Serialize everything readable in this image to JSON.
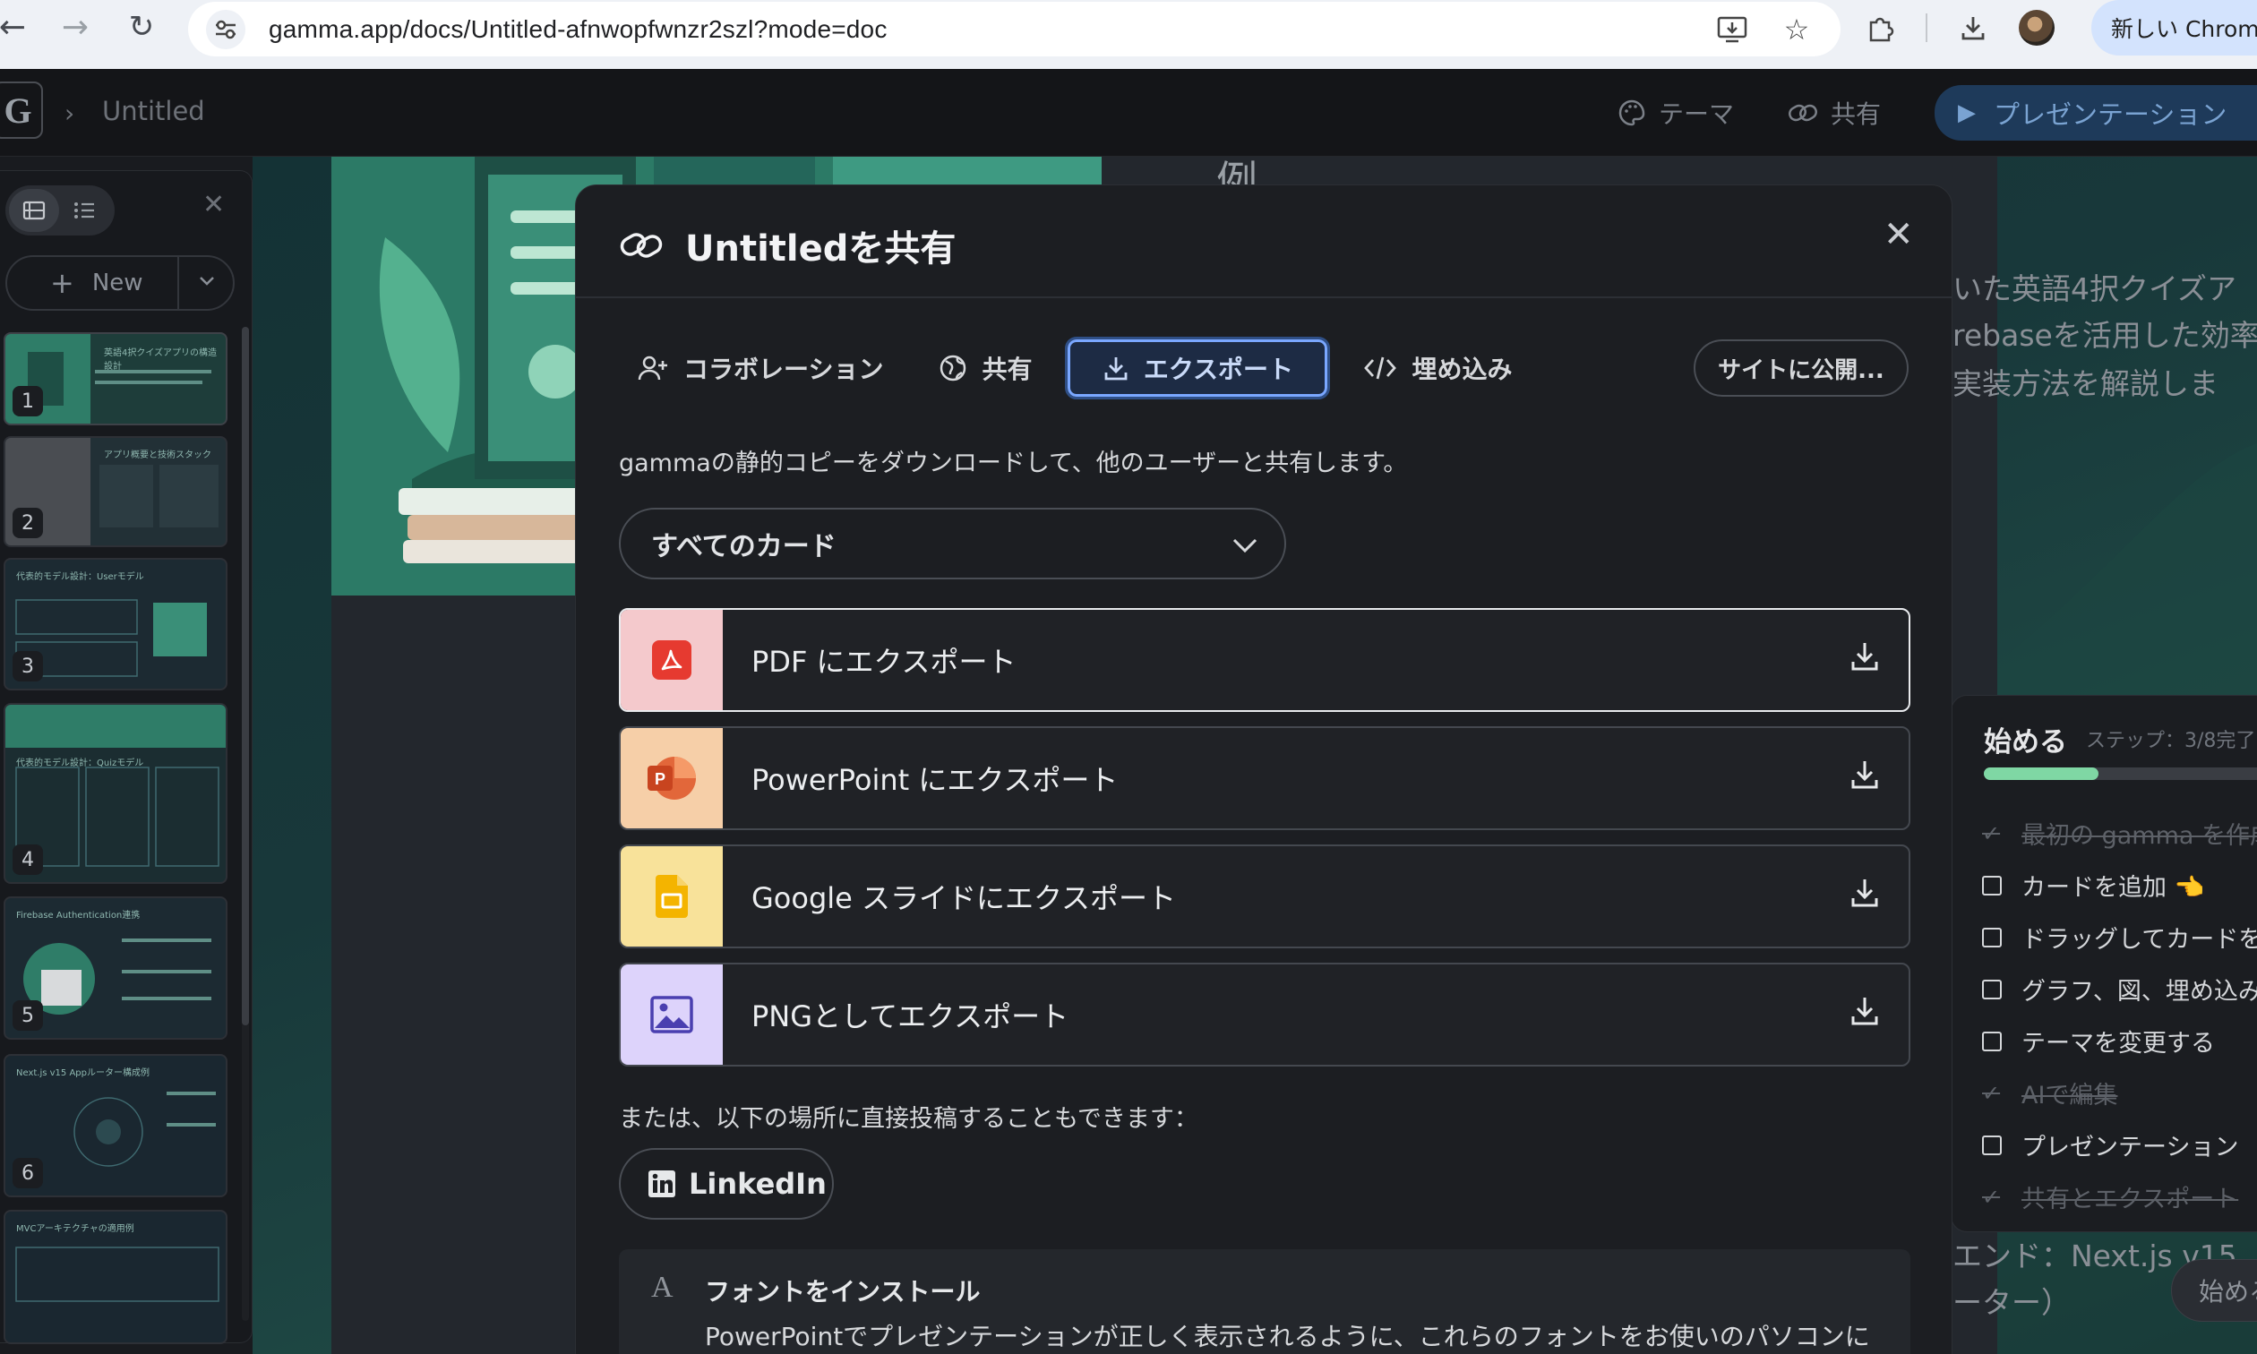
{
  "browser": {
    "url": "gamma.app/docs/Untitled-afnwopfwnzr2szl?mode=doc",
    "new_chrome_label": "新しい Chrom"
  },
  "header": {
    "logo_letter": "G",
    "doc_title": "Untitled",
    "theme_label": "テーマ",
    "share_label": "共有",
    "present_label": "プレゼンテーション"
  },
  "left_panel": {
    "new_label": "New",
    "thumbnails": [
      {
        "num": "1",
        "caption": "英語4択クイズアプリの構造設計"
      },
      {
        "num": "2",
        "caption": "アプリ概要と技術スタック"
      },
      {
        "num": "3",
        "caption": "代表的モデル設計：Userモデル"
      },
      {
        "num": "4",
        "caption": "代表的モデル設計：Quizモデル"
      },
      {
        "num": "5",
        "caption": "Firebase Authentication連携"
      },
      {
        "num": "6",
        "caption": "Next.js v15 Appルーター構成例"
      },
      {
        "num": "",
        "caption": "MVCアーキテクチャの適用例"
      }
    ]
  },
  "background_doc": {
    "heading_fragment": "例",
    "line1": "いた英語4択クイズア",
    "line2": "rebaseを活用した効率",
    "line3": "実装方法を解説しま",
    "line4": "エンド：Next.js v15",
    "line5": "ーター）"
  },
  "getting_started": {
    "title": "始める",
    "step": "ステップ：3/8完了",
    "progress": 0.375,
    "start_button": "始める",
    "items": [
      {
        "label": "最初の gamma を作成",
        "done": true
      },
      {
        "label": "カードを追加 👈",
        "done": false
      },
      {
        "label": "ドラッグしてカードを",
        "done": false
      },
      {
        "label": "グラフ、図、埋め込み",
        "done": false
      },
      {
        "label": "テーマを変更する",
        "done": false
      },
      {
        "label": "AIで編集",
        "done": true
      },
      {
        "label": "プレゼンテーション",
        "done": false
      },
      {
        "label": "共有とエクスポート",
        "done": true
      }
    ]
  },
  "modal": {
    "title": "Untitledを共有",
    "tabs": [
      {
        "label": "コラボレーション"
      },
      {
        "label": "共有"
      },
      {
        "label": "エクスポート"
      },
      {
        "label": "埋め込み"
      }
    ],
    "publish_label": "サイトに公開...",
    "description": "gammaの静的コピーをダウンロードして、他のユーザーと共有します。",
    "select_value": "すべてのカード",
    "export_options": [
      {
        "label": "PDF にエクスポート",
        "color": "#f4c9cc"
      },
      {
        "label": "PowerPoint にエクスポート",
        "color": "#f6cfa8"
      },
      {
        "label": "Google スライドにエクスポート",
        "color": "#f8e29a"
      },
      {
        "label": "PNGとしてエクスポート",
        "color": "#ddd3fb"
      }
    ],
    "or_text": "または、以下の場所に直接投稿することもできます：",
    "linkedin_label": "LinkedIn",
    "font_title": "フォントをインストール",
    "font_desc": "PowerPointでプレゼンテーションが正しく表示されるように、これらのフォントをお使いのパソコンに"
  }
}
